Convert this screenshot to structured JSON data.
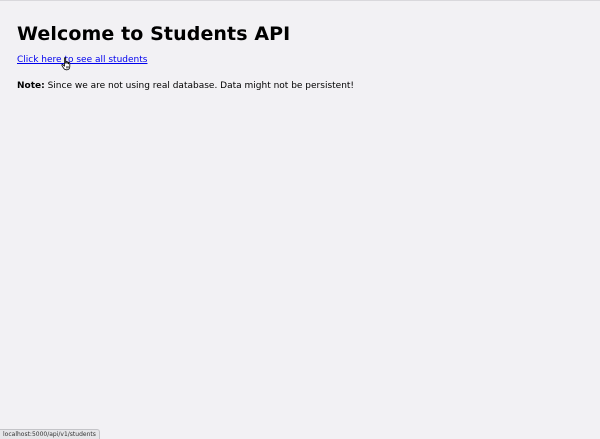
{
  "page": {
    "heading": "Welcome to Students API",
    "link_text": "Click here to see all students",
    "note_label": "Note:",
    "note_text": " Since we are not using real database. Data might not be persistent!"
  },
  "status_bar": {
    "url": "localhost:5000/api/v1/students"
  },
  "cursor": {
    "icon": "hand-pointer-icon"
  },
  "colors": {
    "background": "#f2f1f4",
    "link": "#0000ee",
    "text": "#000000"
  }
}
